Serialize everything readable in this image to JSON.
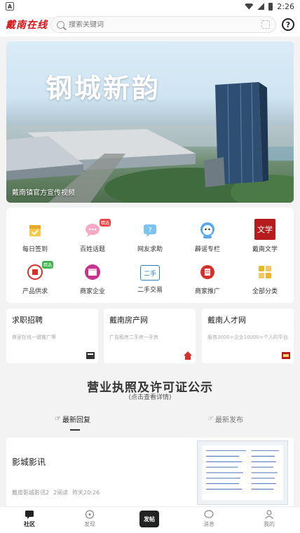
{
  "status_bar": {
    "time": "2:26",
    "left_badge": "A"
  },
  "header": {
    "logo": "戴南在线",
    "search_placeholder": "搜索关键词",
    "help_label": "?"
  },
  "banner": {
    "title": "钢城新韵",
    "caption": "戴南镇官方宣传视频"
  },
  "grid": [
    {
      "label": "每日签到",
      "icon": "calendar-check-icon",
      "badge": ""
    },
    {
      "label": "百姓话题",
      "icon": "chat-bubble-icon",
      "badge": "精选"
    },
    {
      "label": "网友求助",
      "icon": "question-bubble-icon",
      "badge": ""
    },
    {
      "label": "薜谣专栏",
      "icon": "mascot-icon",
      "badge": ""
    },
    {
      "label": "戴南文学",
      "icon": "literature-seal-icon",
      "badge": ""
    },
    {
      "label": "产品供求",
      "icon": "supply-demand-icon",
      "badge": "精选"
    },
    {
      "label": "商家企业",
      "icon": "storefront-icon",
      "badge": ""
    },
    {
      "label": "二手交易",
      "icon": "secondhand-icon",
      "badge": ""
    },
    {
      "label": "商家推广",
      "icon": "promotion-icon",
      "badge": ""
    },
    {
      "label": "全部分类",
      "icon": "all-categories-icon",
      "badge": ""
    }
  ],
  "literature_seal_text": "文学",
  "secondhand_text": "二手",
  "promos": [
    {
      "title": "求职招聘",
      "desc": "商家在线一键推广等",
      "icon": "recruit-icon"
    },
    {
      "title": "戴南房产网",
      "desc": "广告租房二手房一手房",
      "icon": "house-icon"
    },
    {
      "title": "戴南人才网",
      "desc": "服务3000+企业10000+个人的平台",
      "icon": "talent-icon"
    }
  ],
  "notice": {
    "title": "营业执照及许可证公示",
    "subtitle": "(点击查看详情)"
  },
  "tabs": {
    "latest_reply": "最新回复",
    "latest_post": "最新发布"
  },
  "post": {
    "title": "影城影讯",
    "author": "戴南影城影讯2",
    "reads": "2阅读",
    "time": "昨天20:26"
  },
  "bottom_nav": {
    "community": "社区",
    "discover": "发现",
    "post": "发帖",
    "messages": "消息",
    "mine": "我的"
  },
  "colors": {
    "brand_red": "#d4161b",
    "badge_red": "#e64545",
    "badge_green": "#3bb24a"
  }
}
